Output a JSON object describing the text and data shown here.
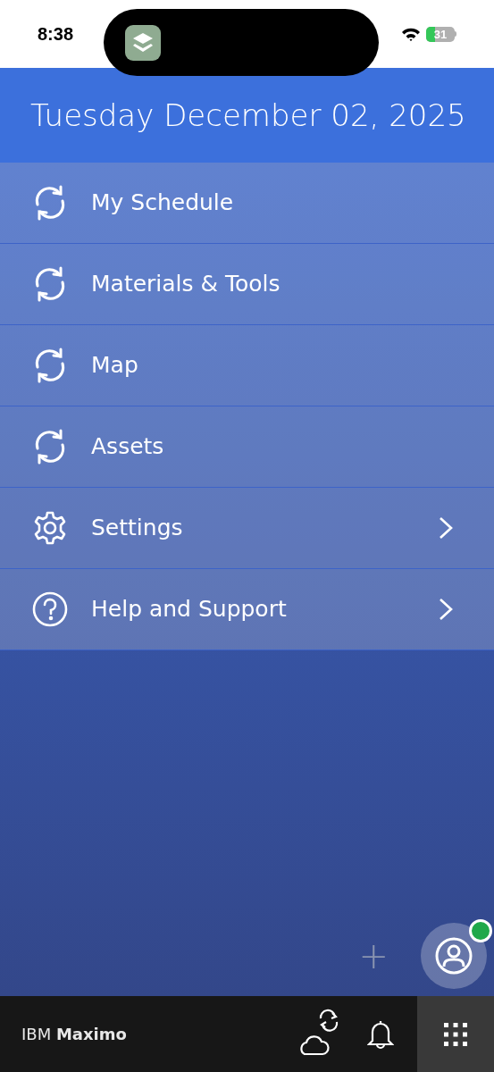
{
  "status_bar": {
    "time": "8:38",
    "battery": "31"
  },
  "header": {
    "date": "Tuesday December 02, 2025"
  },
  "menu": [
    {
      "kind": "sync",
      "label": "My Schedule",
      "chevron": false
    },
    {
      "kind": "sync",
      "label": "Materials & Tools",
      "chevron": false
    },
    {
      "kind": "sync",
      "label": "Map",
      "chevron": false
    },
    {
      "kind": "sync",
      "label": "Assets",
      "chevron": false
    },
    {
      "kind": "settings",
      "label": "Settings",
      "chevron": true
    },
    {
      "kind": "help",
      "label": "Help and Support",
      "chevron": true
    }
  ],
  "fab": {
    "add": "+"
  },
  "bottom_bar": {
    "brand": "IBM **Maximo**"
  }
}
